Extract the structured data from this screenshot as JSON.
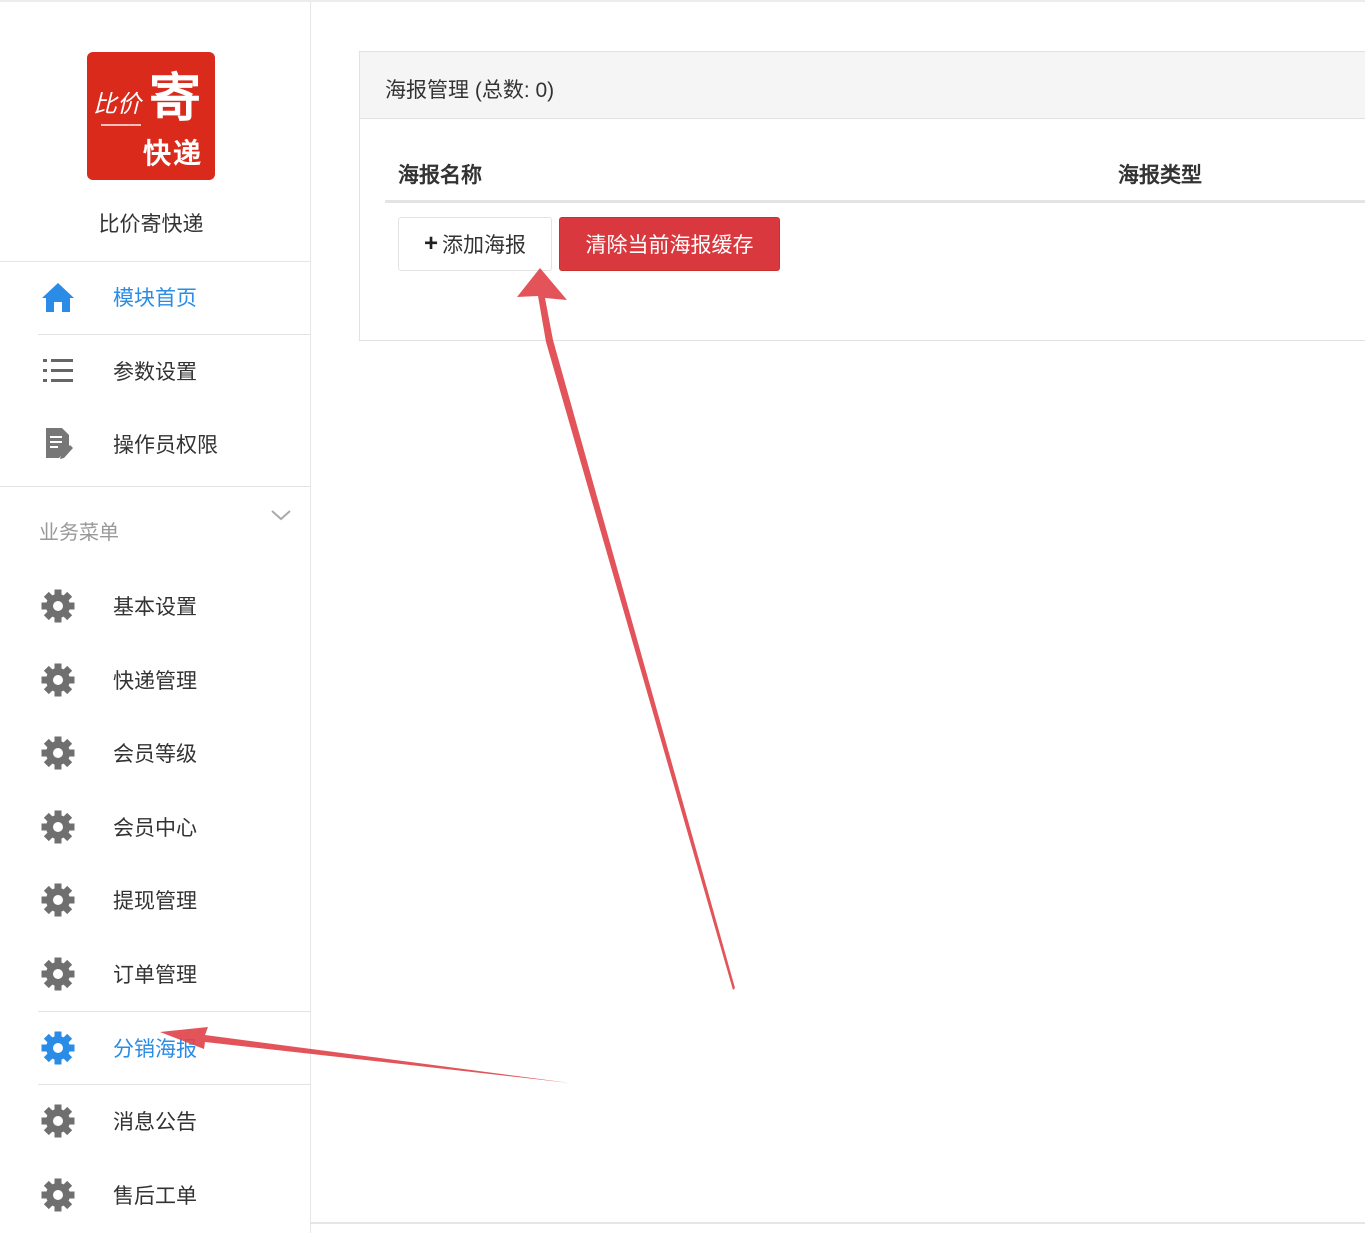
{
  "brand": {
    "logo_line1": "比价",
    "logo_line2": "寄",
    "logo_line3": "快递",
    "name": "比价寄快递",
    "color": "#d92a1c"
  },
  "sidebar": {
    "top_items": [
      {
        "label": "模块首页",
        "icon": "home-icon",
        "active": true
      },
      {
        "label": "参数设置",
        "icon": "list-icon",
        "active": false
      },
      {
        "label": "操作员权限",
        "icon": "document-edit-icon",
        "active": false
      }
    ],
    "group_label": "业务菜单",
    "group_items": [
      {
        "label": "基本设置",
        "icon": "gear-icon"
      },
      {
        "label": "快递管理",
        "icon": "gear-icon"
      },
      {
        "label": "会员等级",
        "icon": "gear-icon"
      },
      {
        "label": "会员中心",
        "icon": "gear-icon"
      },
      {
        "label": "提现管理",
        "icon": "gear-icon"
      },
      {
        "label": "订单管理",
        "icon": "gear-icon"
      },
      {
        "label": "分销海报",
        "icon": "gear-icon",
        "active": true
      },
      {
        "label": "消息公告",
        "icon": "gear-icon"
      },
      {
        "label": "售后工单",
        "icon": "gear-icon"
      }
    ]
  },
  "panel": {
    "title": "海报管理 (总数: 0)",
    "columns": [
      "海报名称",
      "海报类型"
    ],
    "add_button": "添加海报",
    "clear_button": "清除当前海报缓存"
  },
  "colors": {
    "accent": "#2a8ce6",
    "danger": "#d9393e",
    "arrow": "#e0454b"
  }
}
